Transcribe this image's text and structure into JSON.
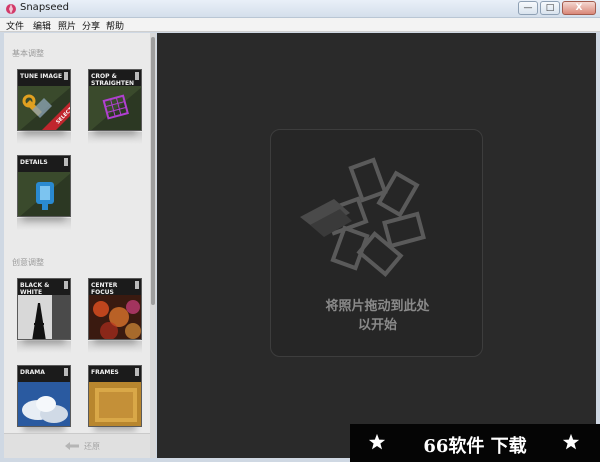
{
  "window": {
    "title": "Snapseed",
    "min_glyph": "—",
    "max_glyph": "□",
    "close_glyph": "X"
  },
  "menu": {
    "items": [
      "文件",
      "编辑",
      "照片",
      "分享",
      "帮助"
    ]
  },
  "sidebar": {
    "section_basic": "基本调整",
    "section_creative": "创意调整",
    "tiles": [
      {
        "label": "TUNE IMAGE",
        "badge": "SELECTIVE",
        "icon": "tools-icon"
      },
      {
        "label": "CROP &\nSTRAIGHTEN",
        "icon": "crop-icon"
      },
      {
        "label": "DETAILS",
        "icon": "detail-magnifier-icon"
      },
      {
        "label": "BLACK &\nWHITE",
        "icon": "eiffel-photo"
      },
      {
        "label": "CENTER\nFOCUS",
        "icon": "bokeh-photo"
      },
      {
        "label": "DRAMA",
        "icon": "cloud-photo"
      },
      {
        "label": "FRAMES",
        "icon": "frame-photo"
      }
    ],
    "undo_label": "还原"
  },
  "canvas": {
    "drop_line1": "将照片拖动到此处",
    "drop_line2": "以开始"
  },
  "banner": {
    "text": "66软件 下载",
    "star": "★"
  },
  "colors": {
    "canvas_bg": "#2a2a2a",
    "sidebar_bg": "#eaeaea",
    "accent_red": "#c0262d"
  }
}
